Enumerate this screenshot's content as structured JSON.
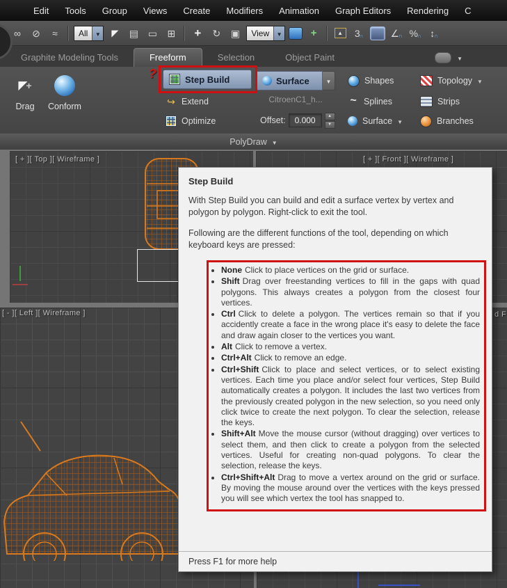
{
  "menu": {
    "items": [
      "Edit",
      "Tools",
      "Group",
      "Views",
      "Create",
      "Modifiers",
      "Animation",
      "Graph Editors",
      "Rendering",
      "C"
    ]
  },
  "toolbar": {
    "selection_filter": "All",
    "reference_coordinate": "View",
    "icons": [
      {
        "name": "select-and-link-icon",
        "glyph": "∞"
      },
      {
        "name": "unlink-selection-icon",
        "glyph": "⊘"
      },
      {
        "name": "bind-to-space-warp-icon",
        "glyph": "≈"
      },
      {
        "name": "select-object-icon",
        "glyph": "◤"
      },
      {
        "name": "select-by-name-icon",
        "glyph": "▤"
      },
      {
        "name": "rectangular-selection-region-icon",
        "glyph": "▭"
      },
      {
        "name": "window-crossing-icon",
        "glyph": "⊞"
      },
      {
        "name": "select-and-move-icon",
        "glyph": "+"
      },
      {
        "name": "select-and-rotate-icon",
        "glyph": "↻"
      },
      {
        "name": "select-and-scale-icon",
        "glyph": "▣"
      },
      {
        "name": "select-and-manipulate-icon",
        "glyph": "+"
      },
      {
        "name": "mirror-icon",
        "glyph": "▲"
      },
      {
        "name": "snap-toggle-icon",
        "glyph": "3",
        "sub": "∩"
      },
      {
        "name": "angle-snap-icon",
        "glyph": "∠",
        "sub": "∩"
      },
      {
        "name": "percent-snap-icon",
        "glyph": "%",
        "sub": "∩"
      },
      {
        "name": "spinner-snap-icon",
        "glyph": "↕",
        "sub": "∩"
      }
    ]
  },
  "ribbon": {
    "tabs": [
      {
        "label": "Graphite Modeling Tools",
        "active": false
      },
      {
        "label": "Freeform",
        "active": true
      },
      {
        "label": "Selection",
        "active": false
      },
      {
        "label": "Object Paint",
        "active": false
      }
    ],
    "drag_label": "Drag",
    "conform_label": "Conform",
    "step_build_label": "Step Build",
    "extend_label": "Extend",
    "optimize_label": "Optimize",
    "surface_dropdown_label": "Surface",
    "surface_object_name": "CitroenC1_h...",
    "offset_label": "Offset:",
    "offset_value": "0.000",
    "shapes_label": "Shapes",
    "splines_label": "Splines",
    "surface_row_label": "Surface",
    "topology_label": "Topology",
    "strips_label": "Strips",
    "branches_label": "Branches",
    "polydraw_label": "PolyDraw"
  },
  "viewports": {
    "top_label": "[ + ][ Top ][ Wireframe ]",
    "front_label": "[ + ][ Front ][ Wireframe ]",
    "left_label": "[ - ][ Left ][ Wireframe ]",
    "right_fragment": "d F"
  },
  "tooltip": {
    "title": "Step Build",
    "intro": "With Step Build you can build and edit a surface vertex by vertex and polygon by polygon. Right-click to exit the tool.",
    "following": "Following are the different functions of the tool, depending on which keyboard keys are pressed:",
    "bullets": [
      {
        "key": "None",
        "text": "Click to place vertices on the grid or surface."
      },
      {
        "key": "Shift",
        "text": "Drag over freestanding vertices to fill in the gaps with quad polygons. This always creates a polygon from the closest four vertices."
      },
      {
        "key": "Ctrl",
        "text": "Click to delete a polygon. The vertices remain so that if you accidently create a face in the wrong place it's easy to delete the face and draw again closer to the vertices you want."
      },
      {
        "key": "Alt",
        "text": "Click to remove a vertex."
      },
      {
        "key": "Ctrl+Alt",
        "text": "Click to remove an edge."
      },
      {
        "key": "Ctrl+Shift",
        "text": "Click to place and select vertices, or to select existing vertices. Each time you place and/or select four vertices, Step Build automatically creates a polygon. It includes the last two vertices from the previously created polygon in the new selection, so you need only click twice to create the next polygon. To clear the selection, release the keys."
      },
      {
        "key": "Shift+Alt",
        "text": "Move the mouse cursor (without dragging) over vertices to select them, and then click to create a polygon from the selected vertices. Useful for creating non-quad polygons. To clear the selection, release the keys."
      },
      {
        "key": "Ctrl+Shift+Alt",
        "text": "Drag to move a vertex around on the grid or surface. By moving the mouse around over the vertices with the keys pressed you will see which vertex the tool has snapped to."
      }
    ],
    "footer": "Press F1 for more help"
  },
  "colors": {
    "annotation_red": "#d01010",
    "wireframe_orange": "#d97a1e",
    "button_highlight_blue": "#8ba6c8",
    "tooltip_bg": "#f1f1f1",
    "ribbon_bg": "#4b4b4b"
  }
}
